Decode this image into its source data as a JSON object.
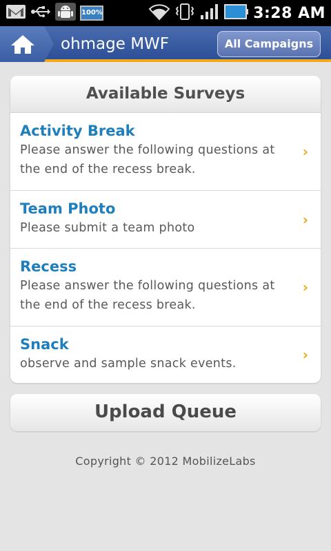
{
  "status_bar": {
    "time": "3:28 AM",
    "battery_label": "100%",
    "icons": [
      "gmail-icon",
      "usb-icon",
      "android-debug-icon",
      "battery-full-icon",
      "wifi-icon",
      "vibrate-icon",
      "signal-icon",
      "battery-icon"
    ]
  },
  "title_bar": {
    "title": "ohmage MWF",
    "campaigns_button": "All Campaigns"
  },
  "surveys": {
    "header": "Available Surveys",
    "items": [
      {
        "title": "Activity Break",
        "description": "Please answer the following questions at the end of the recess break."
      },
      {
        "title": "Team Photo",
        "description": "Please submit a team photo"
      },
      {
        "title": "Recess",
        "description": "Please answer the following questions at the end of the recess break."
      },
      {
        "title": "Snack",
        "description": "observe and sample snack events."
      }
    ]
  },
  "upload_queue": {
    "label": "Upload Queue"
  },
  "footer": {
    "copyright": "Copyright © 2012 MobilizeLabs"
  },
  "colors": {
    "accent_orange": "#f3a81a",
    "title_bar_blue": "#2c4f97",
    "survey_title_blue": "#1f7fbc"
  }
}
